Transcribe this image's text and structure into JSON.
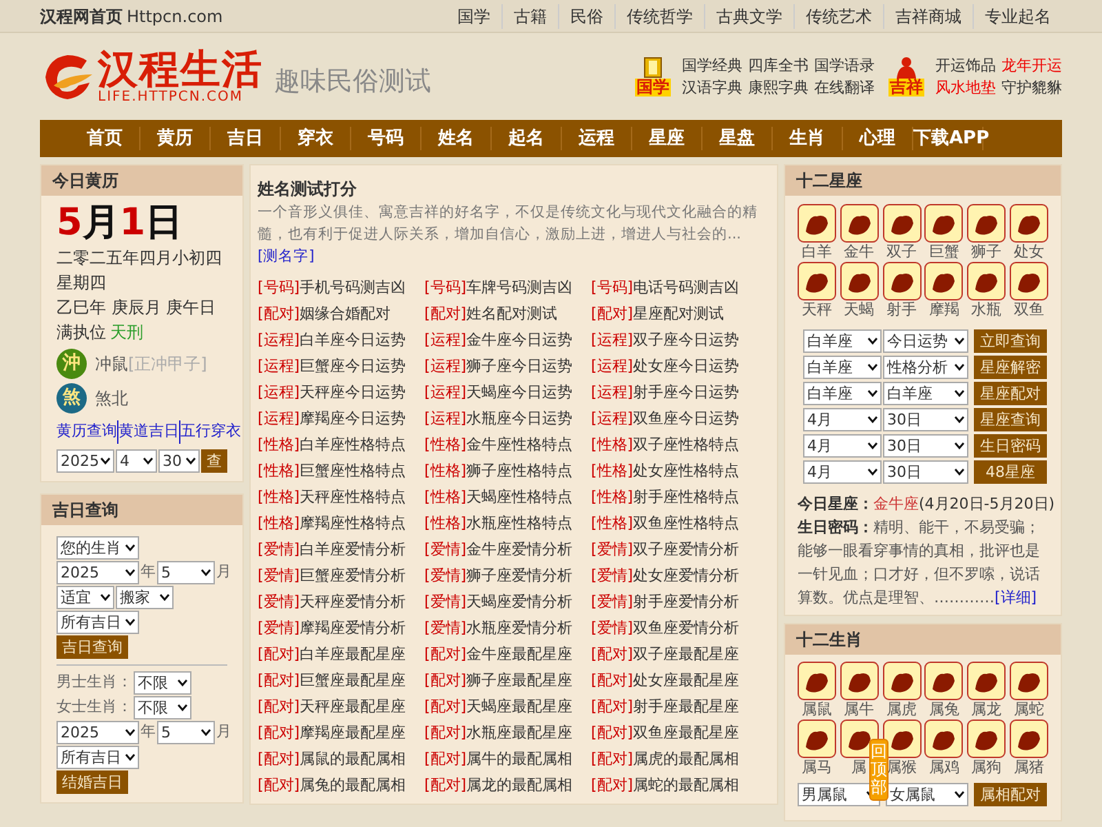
{
  "top_bar": {
    "home": "汉程网首页",
    "domain": "Httpcn.com",
    "links": [
      "国学",
      "古籍",
      "民俗",
      "传统哲学",
      "古典文学",
      "传统艺术",
      "吉祥商城",
      "专业起名"
    ]
  },
  "header": {
    "logo_title": "汉程生活",
    "logo_url": "LIFE.HTTPCN.COM",
    "slogan": "趣味民俗测试",
    "groups": [
      {
        "kind": "book",
        "badge": "国学",
        "rows": [
          [
            {
              "text": "国学经典",
              "highlight": false
            },
            {
              "text": "四库全书",
              "highlight": false
            },
            {
              "text": "国学语录",
              "highlight": false
            }
          ],
          [
            {
              "text": "汉语字典",
              "highlight": false
            },
            {
              "text": "康熙字典",
              "highlight": false
            },
            {
              "text": "在线翻译",
              "highlight": false
            }
          ]
        ]
      },
      {
        "kind": "figure",
        "badge": "吉祥",
        "rows": [
          [
            {
              "text": "开运饰品",
              "highlight": false
            },
            {
              "text": "龙年开运",
              "highlight": true
            }
          ],
          [
            {
              "text": "风水地垫",
              "highlight": true
            },
            {
              "text": "守护貔貅",
              "highlight": false
            }
          ]
        ]
      }
    ]
  },
  "nav": [
    "首页",
    "黄历",
    "吉日",
    "穿衣",
    "号码",
    "姓名",
    "起名",
    "运程",
    "星座",
    "星盘",
    "生肖",
    "心理",
    "下载APP"
  ],
  "almanac": {
    "title": "今日黄历",
    "date_parts": [
      {
        "text": "5",
        "accent": true
      },
      {
        "text": "月",
        "accent": false
      },
      {
        "text": "1",
        "accent": true
      },
      {
        "text": "日",
        "accent": false
      }
    ],
    "lines": [
      "二零二五年四月小初四",
      "星期四",
      "乙巳年 庚辰月 庚午日"
    ],
    "duty": {
      "label": "满执位",
      "value": "天刑"
    },
    "marks": [
      {
        "kind": "clash",
        "glyph": "沖",
        "text": "冲鼠",
        "note": "[正冲甲子]"
      },
      {
        "kind": "evil",
        "glyph": "煞",
        "text": "煞北"
      }
    ],
    "links": [
      "黄历查询",
      "黄道吉日",
      "五行穿衣"
    ],
    "selects": [
      "2025",
      "4",
      "30"
    ],
    "button": "查"
  },
  "lucky_day": {
    "title": "吉日查询",
    "sections": [
      {
        "rows": [
          [
            {
              "kind": "select",
              "value": "您的生肖"
            }
          ],
          [
            {
              "kind": "select",
              "value": "2025"
            },
            {
              "kind": "label",
              "value": "年"
            },
            {
              "kind": "select",
              "value": "5"
            },
            {
              "kind": "label",
              "value": "月"
            }
          ],
          [
            {
              "kind": "select",
              "value": "适宜"
            },
            {
              "kind": "select",
              "value": "搬家"
            }
          ],
          [
            {
              "kind": "select",
              "value": "所有吉日"
            }
          ],
          [
            {
              "kind": "button",
              "value": "吉日查询"
            }
          ]
        ]
      },
      {
        "rows": [
          [
            {
              "kind": "label",
              "value": "男士生肖："
            },
            {
              "kind": "select",
              "value": "不限"
            }
          ],
          [
            {
              "kind": "label",
              "value": "女士生肖："
            },
            {
              "kind": "select",
              "value": "不限"
            }
          ],
          [
            {
              "kind": "select",
              "value": "2025"
            },
            {
              "kind": "label",
              "value": "年"
            },
            {
              "kind": "select",
              "value": "5"
            },
            {
              "kind": "label",
              "value": "月"
            }
          ],
          [
            {
              "kind": "select",
              "value": "所有吉日"
            }
          ],
          [
            {
              "kind": "button",
              "value": "结婚吉日"
            }
          ]
        ]
      }
    ]
  },
  "name_test": {
    "title": "姓名测试打分",
    "intro": "一个音形义俱佳、寓意吉祥的好名字，不仅是传统文化与现代文化融合的精髓，也有利于促进人际关系，增加自信心，激励上进，增进人与社会的...",
    "more": "[测名字]",
    "links": [
      {
        "tag": "[号码]",
        "text": "手机号码测吉凶"
      },
      {
        "tag": "[号码]",
        "text": "车牌号码测吉凶"
      },
      {
        "tag": "[号码]",
        "text": "电话号码测吉凶"
      },
      {
        "tag": "[配对]",
        "text": "姻缘合婚配对"
      },
      {
        "tag": "[配对]",
        "text": "姓名配对测试"
      },
      {
        "tag": "[配对]",
        "text": "星座配对测试"
      },
      {
        "tag": "[运程]",
        "text": "白羊座今日运势"
      },
      {
        "tag": "[运程]",
        "text": "金牛座今日运势"
      },
      {
        "tag": "[运程]",
        "text": "双子座今日运势"
      },
      {
        "tag": "[运程]",
        "text": "巨蟹座今日运势"
      },
      {
        "tag": "[运程]",
        "text": "狮子座今日运势"
      },
      {
        "tag": "[运程]",
        "text": "处女座今日运势"
      },
      {
        "tag": "[运程]",
        "text": "天秤座今日运势"
      },
      {
        "tag": "[运程]",
        "text": "天蝎座今日运势"
      },
      {
        "tag": "[运程]",
        "text": "射手座今日运势"
      },
      {
        "tag": "[运程]",
        "text": "摩羯座今日运势"
      },
      {
        "tag": "[运程]",
        "text": "水瓶座今日运势"
      },
      {
        "tag": "[运程]",
        "text": "双鱼座今日运势"
      },
      {
        "tag": "[性格]",
        "text": "白羊座性格特点"
      },
      {
        "tag": "[性格]",
        "text": "金牛座性格特点"
      },
      {
        "tag": "[性格]",
        "text": "双子座性格特点"
      },
      {
        "tag": "[性格]",
        "text": "巨蟹座性格特点"
      },
      {
        "tag": "[性格]",
        "text": "狮子座性格特点"
      },
      {
        "tag": "[性格]",
        "text": "处女座性格特点"
      },
      {
        "tag": "[性格]",
        "text": "天秤座性格特点"
      },
      {
        "tag": "[性格]",
        "text": "天蝎座性格特点"
      },
      {
        "tag": "[性格]",
        "text": "射手座性格特点"
      },
      {
        "tag": "[性格]",
        "text": "摩羯座性格特点"
      },
      {
        "tag": "[性格]",
        "text": "水瓶座性格特点"
      },
      {
        "tag": "[性格]",
        "text": "双鱼座性格特点"
      },
      {
        "tag": "[爱情]",
        "text": "白羊座爱情分析"
      },
      {
        "tag": "[爱情]",
        "text": "金牛座爱情分析"
      },
      {
        "tag": "[爱情]",
        "text": "双子座爱情分析"
      },
      {
        "tag": "[爱情]",
        "text": "巨蟹座爱情分析"
      },
      {
        "tag": "[爱情]",
        "text": "狮子座爱情分析"
      },
      {
        "tag": "[爱情]",
        "text": "处女座爱情分析"
      },
      {
        "tag": "[爱情]",
        "text": "天秤座爱情分析"
      },
      {
        "tag": "[爱情]",
        "text": "天蝎座爱情分析"
      },
      {
        "tag": "[爱情]",
        "text": "射手座爱情分析"
      },
      {
        "tag": "[爱情]",
        "text": "摩羯座爱情分析"
      },
      {
        "tag": "[爱情]",
        "text": "水瓶座爱情分析"
      },
      {
        "tag": "[爱情]",
        "text": "双鱼座爱情分析"
      },
      {
        "tag": "[配对]",
        "text": "白羊座最配星座"
      },
      {
        "tag": "[配对]",
        "text": "金牛座最配星座"
      },
      {
        "tag": "[配对]",
        "text": "双子座最配星座"
      },
      {
        "tag": "[配对]",
        "text": "巨蟹座最配星座"
      },
      {
        "tag": "[配对]",
        "text": "狮子座最配星座"
      },
      {
        "tag": "[配对]",
        "text": "处女座最配星座"
      },
      {
        "tag": "[配对]",
        "text": "天秤座最配星座"
      },
      {
        "tag": "[配对]",
        "text": "天蝎座最配星座"
      },
      {
        "tag": "[配对]",
        "text": "射手座最配星座"
      },
      {
        "tag": "[配对]",
        "text": "摩羯座最配星座"
      },
      {
        "tag": "[配对]",
        "text": "水瓶座最配星座"
      },
      {
        "tag": "[配对]",
        "text": "双鱼座最配星座"
      },
      {
        "tag": "[配对]",
        "text": "属鼠的最配属相"
      },
      {
        "tag": "[配对]",
        "text": "属牛的最配属相"
      },
      {
        "tag": "[配对]",
        "text": "属虎的最配属相"
      },
      {
        "tag": "[配对]",
        "text": "属兔的最配属相"
      },
      {
        "tag": "[配对]",
        "text": "属龙的最配属相"
      },
      {
        "tag": "[配对]",
        "text": "属蛇的最配属相"
      }
    ]
  },
  "zodiac": {
    "title": "十二星座",
    "signs": [
      "白羊",
      "金牛",
      "双子",
      "巨蟹",
      "狮子",
      "处女",
      "天秤",
      "天蝎",
      "射手",
      "摩羯",
      "水瓶",
      "双鱼"
    ],
    "forms": [
      [
        "白羊座",
        "今日运势",
        "立即查询"
      ],
      [
        "白羊座",
        "性格分析",
        "星座解密"
      ],
      [
        "白羊座",
        "白羊座",
        "星座配对"
      ],
      [
        "4月",
        "30日",
        "星座查询"
      ],
      [
        "4月",
        "30日",
        "生日密码"
      ],
      [
        "4月",
        "30日",
        "48星座"
      ]
    ],
    "today": {
      "label": "今日星座：",
      "sign": "金牛座",
      "range": "(4月20日-5月20日)"
    },
    "birthday": {
      "label": "生日密码：",
      "text": "精明、能干，不易受骗；能够一眼看穿事情的真相，批评也是一针见血；口才好，但不罗嗦，说话算数。优点是理智、…………",
      "link": "[详细]"
    }
  },
  "chinese_zodiac": {
    "title": "十二生肖",
    "animals": [
      "属鼠",
      "属牛",
      "属虎",
      "属兔",
      "属龙",
      "属蛇",
      "属马",
      "属",
      "属猴",
      "属鸡",
      "属狗",
      "属猪"
    ],
    "form": [
      "男属鼠",
      "女属鼠",
      "属相配对"
    ]
  },
  "back_to_top": "回顶部"
}
